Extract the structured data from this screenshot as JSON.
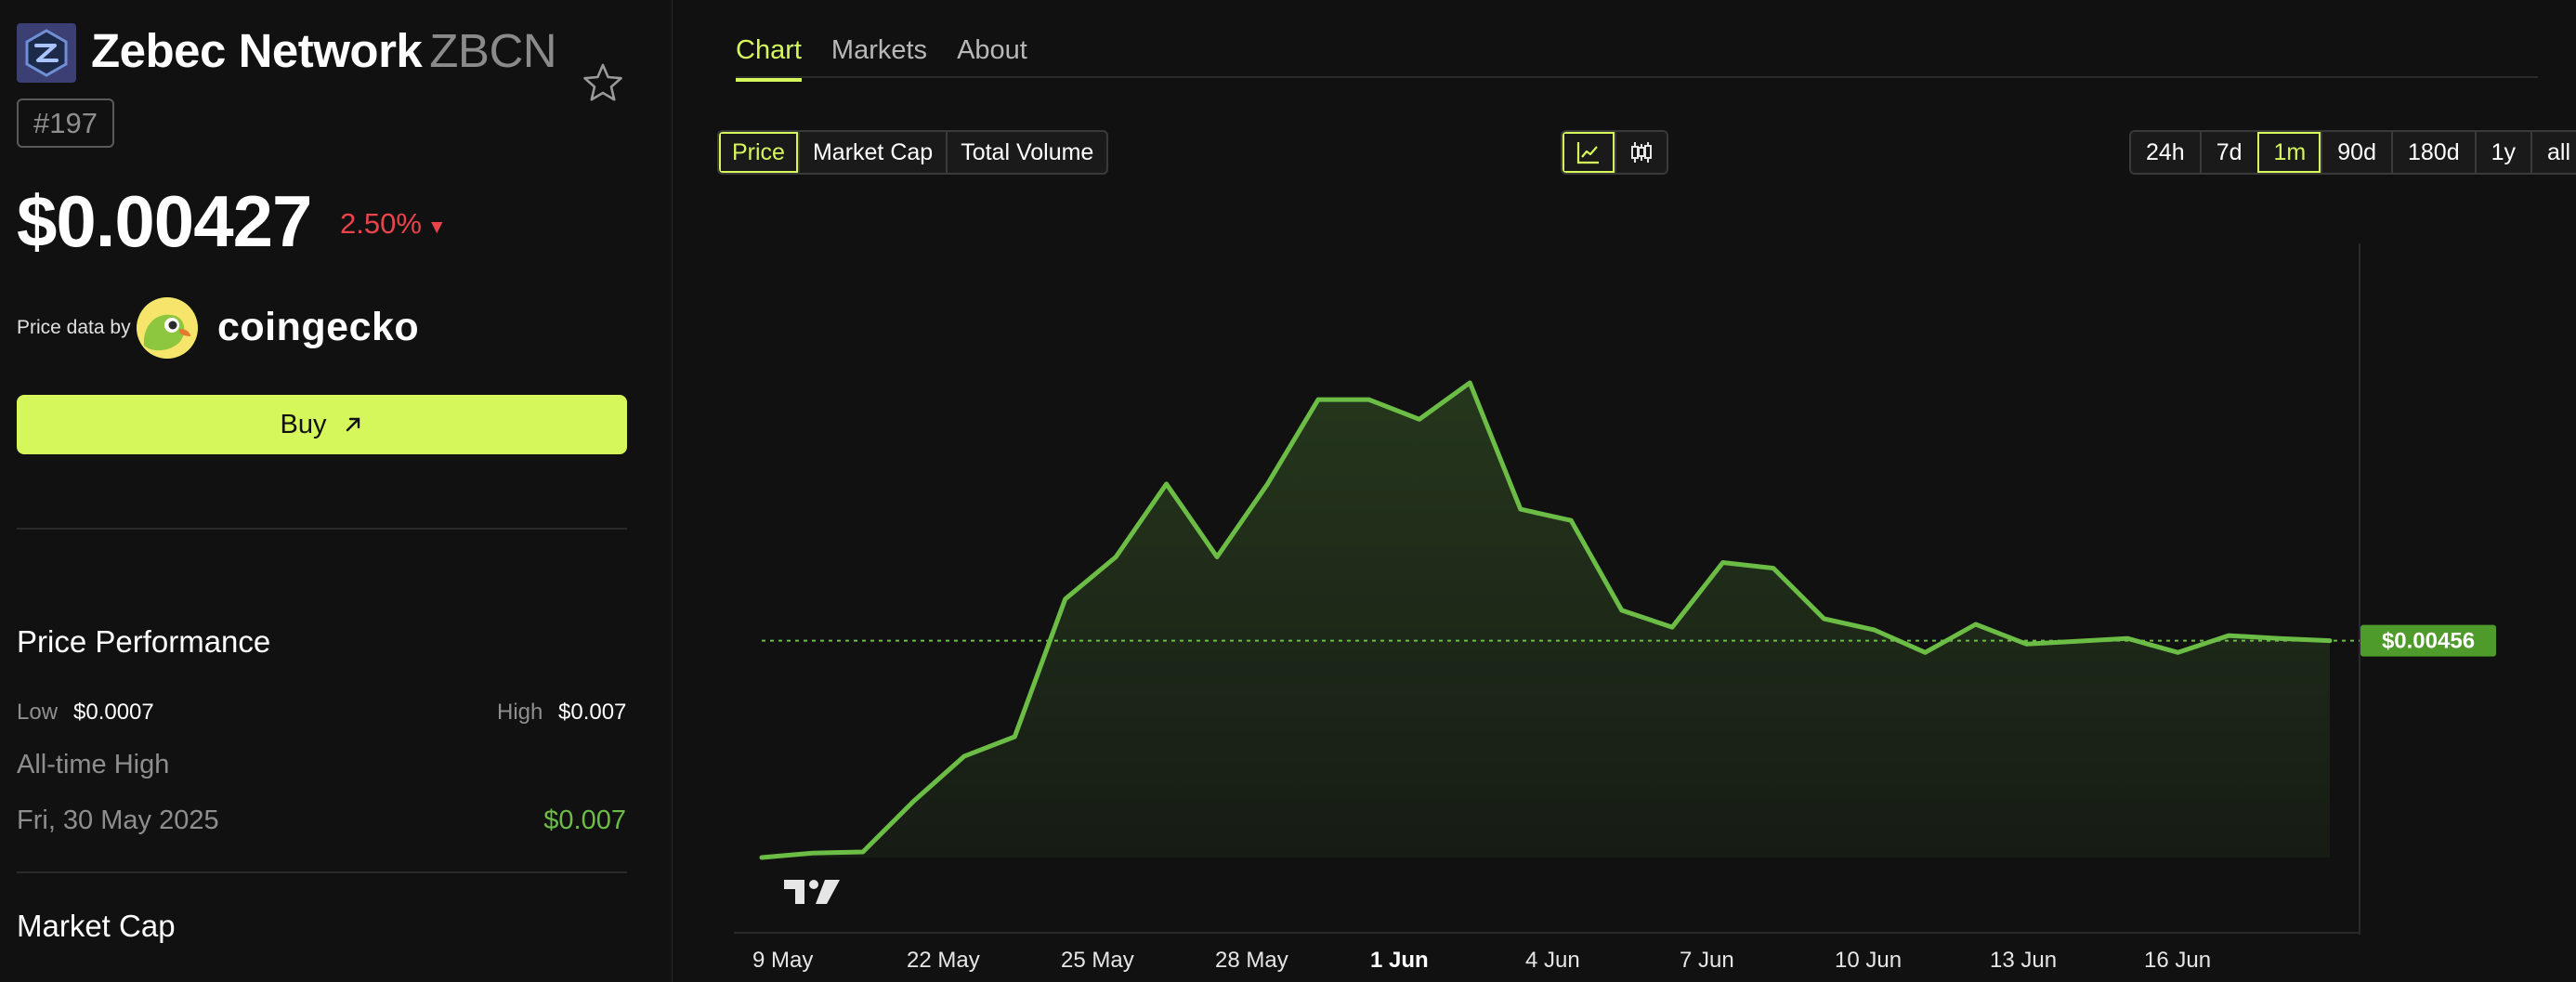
{
  "coin": {
    "name": "Zebec Network",
    "symbol": "ZBCN",
    "rank": "#197",
    "price": "$0.00427",
    "change": "2.50%",
    "change_direction": "down",
    "icon": "zebec-logo-icon"
  },
  "price_source": {
    "label": "Price data by",
    "brand": "coingecko"
  },
  "buy": {
    "label": "Buy"
  },
  "performance": {
    "title": "Price Performance",
    "low_label": "Low",
    "low_value": "$0.0007",
    "high_label": "High",
    "high_value": "$0.007",
    "ath_title": "All-time High",
    "ath_date": "Fri, 30 May 2025",
    "ath_value": "$0.007"
  },
  "market_cap": {
    "title": "Market Cap"
  },
  "tabs": [
    {
      "label": "Chart",
      "active": true
    },
    {
      "label": "Markets",
      "active": false
    },
    {
      "label": "About",
      "active": false
    }
  ],
  "metric_options": [
    {
      "label": "Price",
      "active": true
    },
    {
      "label": "Market Cap",
      "active": false
    },
    {
      "label": "Total Volume",
      "active": false
    }
  ],
  "view_options": [
    {
      "icon": "line-chart-icon",
      "active": true
    },
    {
      "icon": "candlestick-icon",
      "active": false
    }
  ],
  "range_options": [
    {
      "label": "24h",
      "active": false
    },
    {
      "label": "7d",
      "active": false
    },
    {
      "label": "1m",
      "active": true
    },
    {
      "label": "90d",
      "active": false
    },
    {
      "label": "180d",
      "active": false
    },
    {
      "label": "1y",
      "active": false
    },
    {
      "label": "all",
      "active": false
    }
  ],
  "colors": {
    "accent": "#d5f75c",
    "line": "#6cbd45",
    "negative": "#e9434b",
    "background": "#111111"
  },
  "chart_data": {
    "type": "area",
    "x_tick_labels": [
      "9 May",
      "22 May",
      "25 May",
      "28 May",
      "1 Jun",
      "4 Jun",
      "7 Jun",
      "10 Jun",
      "13 Jun",
      "16 Jun"
    ],
    "x_tick_bold": [
      "1 Jun"
    ],
    "current_price_label": "$0.00456",
    "current_price_line": 0.00456,
    "ylim": [
      0.0007,
      0.0083
    ],
    "series": [
      {
        "values": [
          0.0007,
          0.00078,
          0.0008,
          0.0017,
          0.0025,
          0.00285,
          0.0053,
          0.00605,
          0.00735,
          0.00605,
          0.00735,
          0.00885,
          0.00885,
          0.0085,
          0.00915,
          0.0069,
          0.0067,
          0.0051,
          0.0048,
          0.00595,
          0.00585,
          0.00495,
          0.00475,
          0.00435,
          0.00485,
          0.0045,
          0.00455,
          0.0046,
          0.00435,
          0.00465,
          0.0046,
          0.00456
        ]
      }
    ],
    "grid": false,
    "watermark": "TradingView"
  }
}
